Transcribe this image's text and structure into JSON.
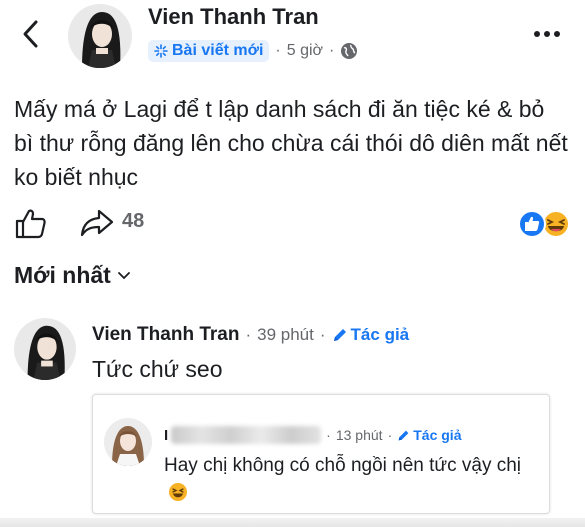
{
  "header": {
    "author_name": "Vien Thanh Tran",
    "badge_label": "Bài viết mới",
    "separator": "·",
    "time": "5 giờ",
    "more_label": "•••"
  },
  "post": {
    "text": "Mấy má ở Lagi để t lập danh sách đi ăn tiệc ké & bỏ bì thư rỗng đăng lên cho chừa cái thói dô diên mất nết ko biết nhục",
    "share_count": "48",
    "reactions": [
      "like",
      "haha"
    ]
  },
  "comments_sort": {
    "label": "Mới nhất"
  },
  "comments": [
    {
      "author": "Vien Thanh Tran",
      "separator": "·",
      "time": "39 phút",
      "author_tag": "Tác giả",
      "text": "Tức chứ seo",
      "reply": {
        "author_initial": "I",
        "author_name_redacted": true,
        "time": "13 phút",
        "separator": "·",
        "author_tag": "Tác giả",
        "text": "Hay chị không có chỗ ngồi nên tức vậy chị",
        "emoji": "laughing"
      }
    }
  ],
  "colors": {
    "brand_blue": "#1877f2",
    "badge_bg": "#e7f0fd",
    "secondary_text": "#65676b",
    "primary_text": "#1c1e21",
    "haha_yellow": "#f7b125"
  }
}
